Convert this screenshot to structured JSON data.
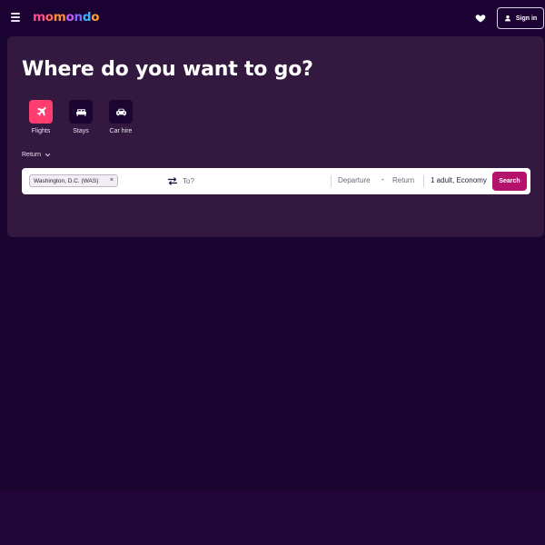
{
  "header": {
    "logo": [
      "m",
      "o",
      "m",
      "o",
      "n",
      "d",
      "o"
    ],
    "sign_in_label": "Sign in",
    "icons": [
      "menu-icon",
      "heart-icon",
      "user-icon"
    ]
  },
  "hero": {
    "title": "Where do you want to go?",
    "verticals": [
      {
        "label": "Flights",
        "icon": "plane-icon",
        "selected": true
      },
      {
        "label": "Stays",
        "icon": "bed-icon",
        "selected": false
      },
      {
        "label": "Car hire",
        "icon": "car-icon",
        "selected": false
      }
    ],
    "trip_type": "Return"
  },
  "search": {
    "origin": "Washington, D.C. (WAS)",
    "destination_placeholder": "To?",
    "departure_placeholder": "Departure",
    "dash": "-",
    "return_placeholder": "Return",
    "travellers": "1 adult, Economy",
    "button_label": "Search"
  },
  "colors": {
    "page_bg": "#1a0430",
    "hero_bg": "#33183f",
    "accent_pink": "#ff3d6e",
    "search_button": "#b5126e"
  }
}
